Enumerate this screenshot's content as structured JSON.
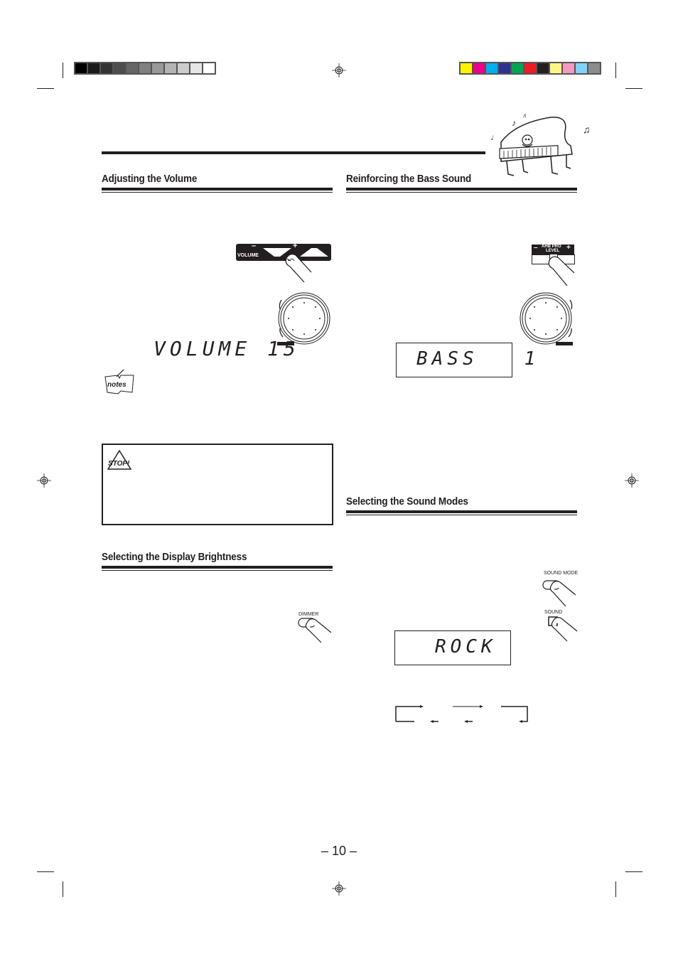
{
  "print_marks": {
    "grayscale": [
      "#000000",
      "#1a1a1a",
      "#333333",
      "#4d4d4d",
      "#666666",
      "#808080",
      "#999999",
      "#b3b3b3",
      "#cccccc",
      "#e6e6e6",
      "#ffffff"
    ],
    "colors": [
      "#fff200",
      "#ec008c",
      "#00aeef",
      "#2e3192",
      "#00a651",
      "#ed1c24",
      "#231f20",
      "#fff685",
      "#f49ac2",
      "#7fd3f7",
      "#8c8c8c"
    ]
  },
  "sections": {
    "volume": {
      "title": "Adjusting the Volume",
      "button_label": "VOLUME",
      "minus": "–",
      "plus": "+",
      "knob_label": "VOLUME",
      "display": "VOLUME 15"
    },
    "bass": {
      "title": "Reinforcing the Bass Sound",
      "button_label_top": "AHB PRO",
      "button_label_bottom": "LEVEL",
      "minus": "–",
      "plus": "+",
      "knob_label": "AHB PRO",
      "display": "BASS   1"
    },
    "brightness": {
      "title": "Selecting the Display Brightness",
      "button_label": "DIMMER"
    },
    "sound_modes": {
      "title": "Selecting the Sound Modes",
      "button_label_main": "SOUND MODE",
      "button_label_remote": "SOUND",
      "display": "ROCK"
    }
  },
  "notes_icon": "notes",
  "stop_icon": "STOP!",
  "page_number": "– 10 –"
}
